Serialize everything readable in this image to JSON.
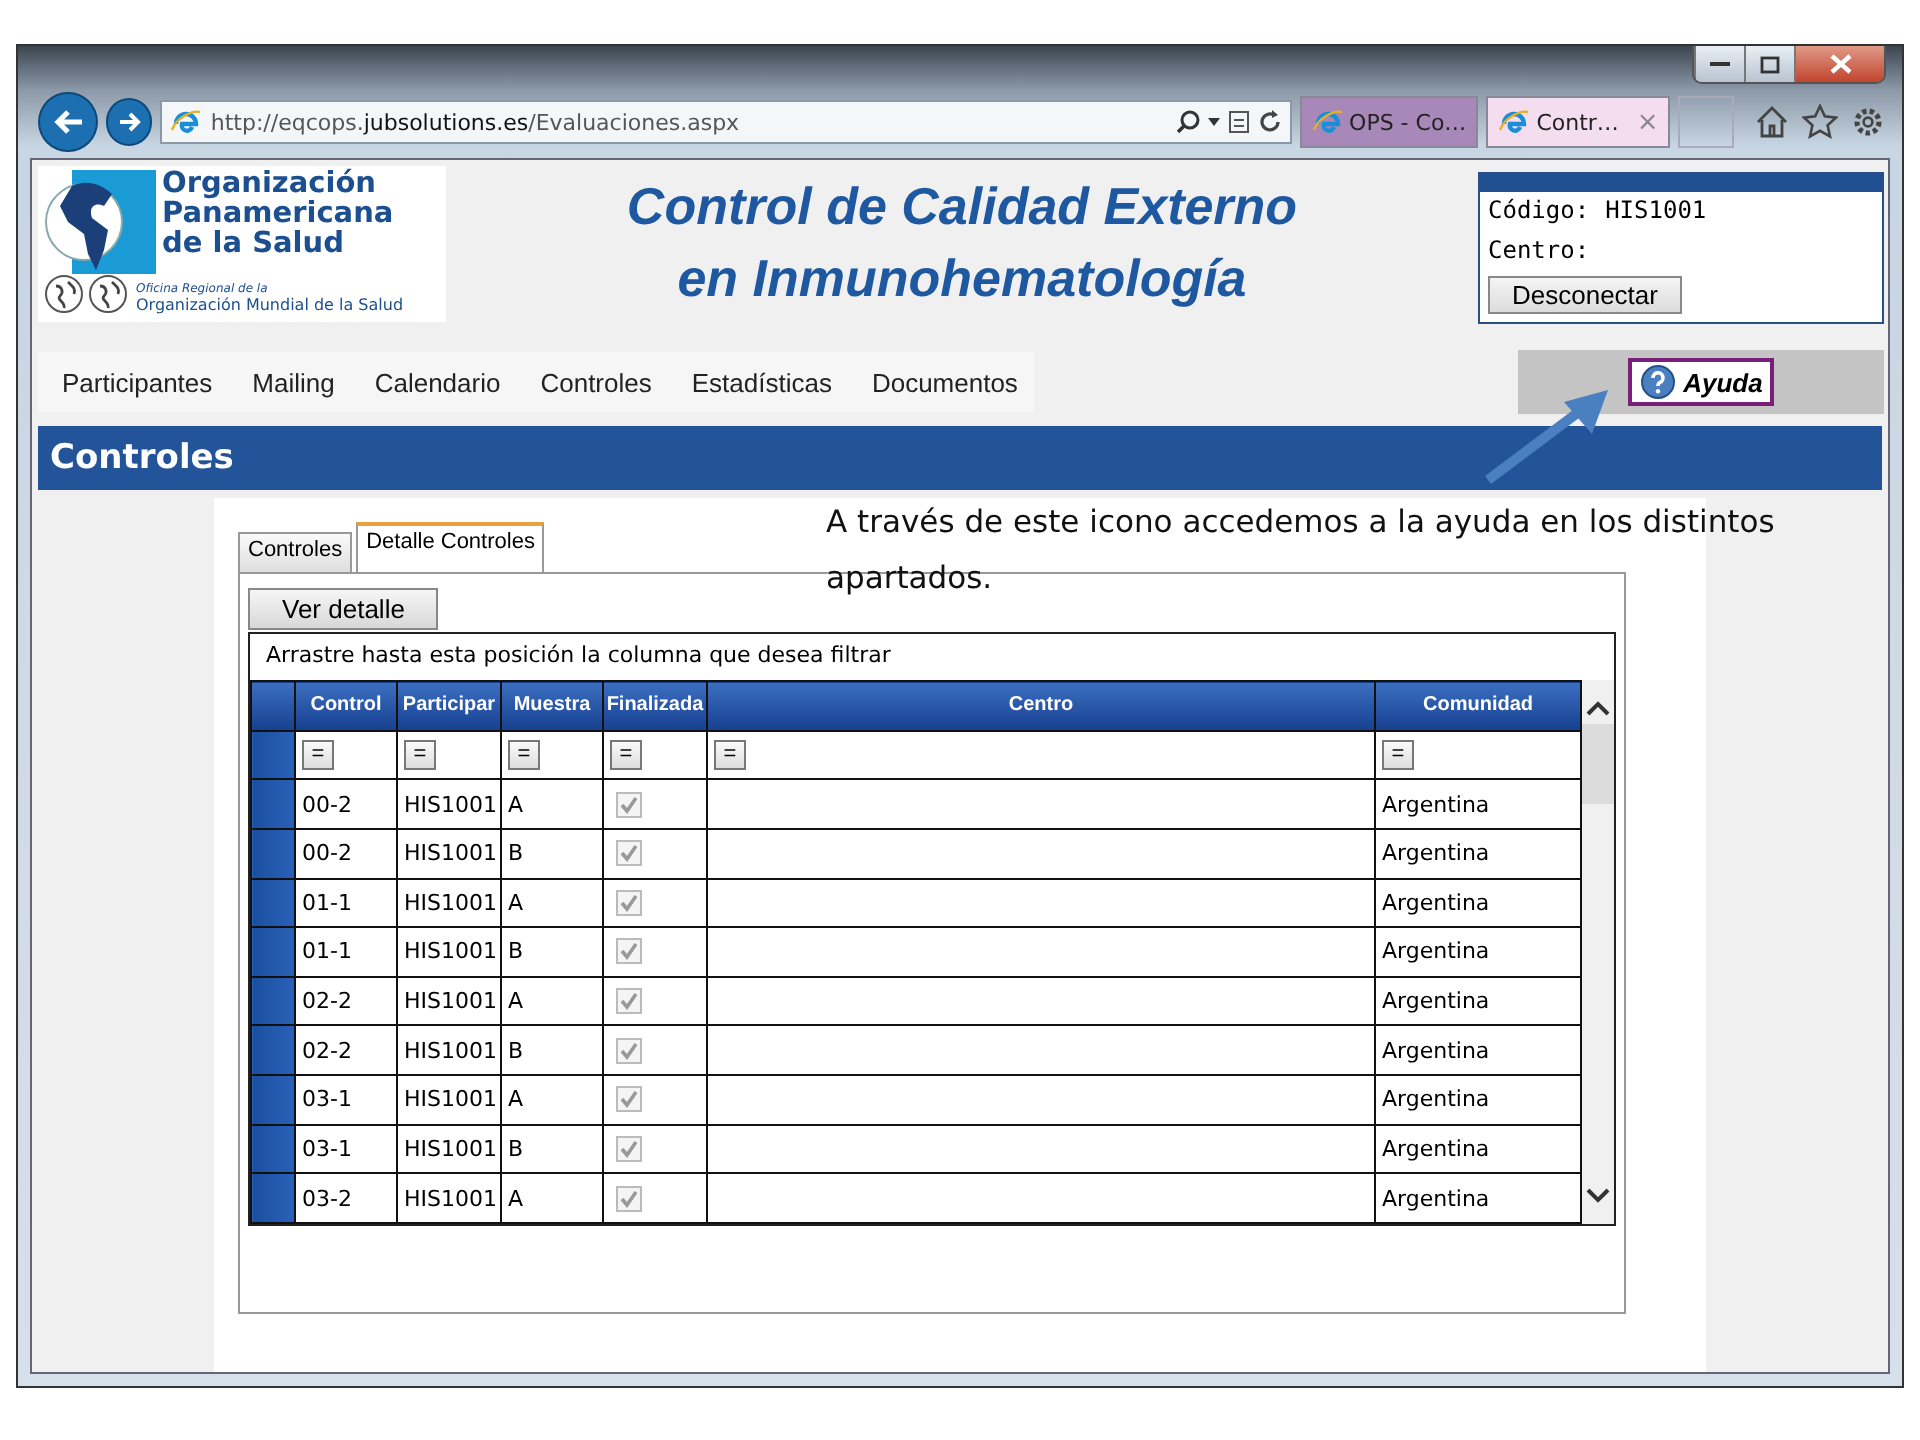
{
  "browser": {
    "url_prefix": "http://eqcops.",
    "url_domain": "jubsolutions.es",
    "url_path": "/Evaluaciones.aspx",
    "tabs": [
      {
        "label": "OPS - Co…",
        "selected": false
      },
      {
        "label": "Contr…",
        "selected": true,
        "close": "×"
      }
    ]
  },
  "logo": {
    "name_lines": [
      "Organización",
      "Panamericana",
      "de la Salud"
    ],
    "subtitle": "Oficina Regional de la",
    "parent": "Organización Mundial de la Salud"
  },
  "title_lines": [
    "Control de Calidad Externo",
    "en Inmunohematología"
  ],
  "login": {
    "code_label": "Código:",
    "code_value": "HIS1001",
    "centre_label": "Centro:",
    "button": "Desconectar"
  },
  "menu": [
    "Participantes",
    "Mailing",
    "Calendario",
    "Controles",
    "Estadísticas",
    "Documentos"
  ],
  "help_button": "Ayuda",
  "section_title": "Controles",
  "annotation": "A través de este icono accedemos a la ayuda en los distintos apartados.",
  "panel_tabs": [
    {
      "label": "Controles",
      "selected": false
    },
    {
      "label": "Detalle Controles",
      "selected": true
    }
  ],
  "detail_button": "Ver detalle",
  "group_hint": "Arrastre hasta esta posición la columna que desea filtrar",
  "table": {
    "columns": [
      {
        "label": "Control",
        "filter": "="
      },
      {
        "label": "Participar",
        "filter": "="
      },
      {
        "label": "Muestra",
        "filter": "="
      },
      {
        "label": "Finalizada",
        "filter": "="
      },
      {
        "label": "Centro",
        "filter": "="
      },
      {
        "label": "Comunidad",
        "filter": "="
      }
    ],
    "rows": [
      {
        "control": "00-2",
        "participant": "HIS1001",
        "sample": "A",
        "finished": true,
        "community": "Argentina"
      },
      {
        "control": "00-2",
        "participant": "HIS1001",
        "sample": "B",
        "finished": true,
        "community": "Argentina"
      },
      {
        "control": "01-1",
        "participant": "HIS1001",
        "sample": "A",
        "finished": true,
        "community": "Argentina"
      },
      {
        "control": "01-1",
        "participant": "HIS1001",
        "sample": "B",
        "finished": true,
        "community": "Argentina"
      },
      {
        "control": "02-2",
        "participant": "HIS1001",
        "sample": "A",
        "finished": true,
        "community": "Argentina"
      },
      {
        "control": "02-2",
        "participant": "HIS1001",
        "sample": "B",
        "finished": true,
        "community": "Argentina"
      },
      {
        "control": "03-1",
        "participant": "HIS1001",
        "sample": "A",
        "finished": true,
        "community": "Argentina"
      },
      {
        "control": "03-1",
        "participant": "HIS1001",
        "sample": "B",
        "finished": true,
        "community": "Argentina"
      },
      {
        "control": "03-2",
        "participant": "HIS1001",
        "sample": "A",
        "finished": true,
        "community": "Argentina"
      }
    ]
  }
}
